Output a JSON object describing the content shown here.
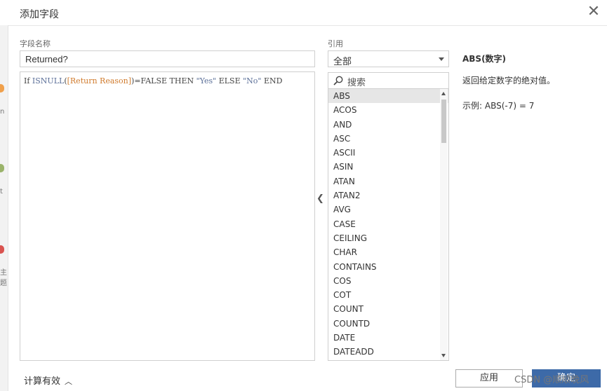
{
  "dialog": {
    "title": "添加字段"
  },
  "left_strip": {
    "labels": [
      "n",
      "t",
      "主题"
    ]
  },
  "field": {
    "label": "字段名称",
    "value": "Returned?"
  },
  "editor": {
    "tokens": {
      "if": "If",
      "func": "ISNULL",
      "open": "(",
      "ref": "[Return Reason]",
      "rest": ")=FALSE THEN ",
      "s1": "\"Yes\"",
      "else": " ELSE ",
      "s2": "\"No\"",
      "end": " END"
    }
  },
  "reference": {
    "label": "引用",
    "selected": "全部",
    "search_placeholder": "搜索",
    "functions": [
      "ABS",
      "ACOS",
      "AND",
      "ASC",
      "ASCII",
      "ASIN",
      "ATAN",
      "ATAN2",
      "AVG",
      "CASE",
      "CEILING",
      "CHAR",
      "CONTAINS",
      "COS",
      "COT",
      "COUNT",
      "COUNTD",
      "DATE",
      "DATEADD"
    ],
    "selected_index": 0
  },
  "help": {
    "title": "ABS(数字)",
    "description": "返回给定数字的绝对值。",
    "example": "示例: ABS(-7) = 7"
  },
  "status": {
    "label": "计算有效"
  },
  "buttons": {
    "apply": "应用",
    "ok": "确定"
  },
  "watermark": "CSDN @顺顺晚风",
  "colors": {
    "primary": "#3d6aa8",
    "reference_field": "#d07b2d",
    "keyword": "#5b6f98"
  }
}
